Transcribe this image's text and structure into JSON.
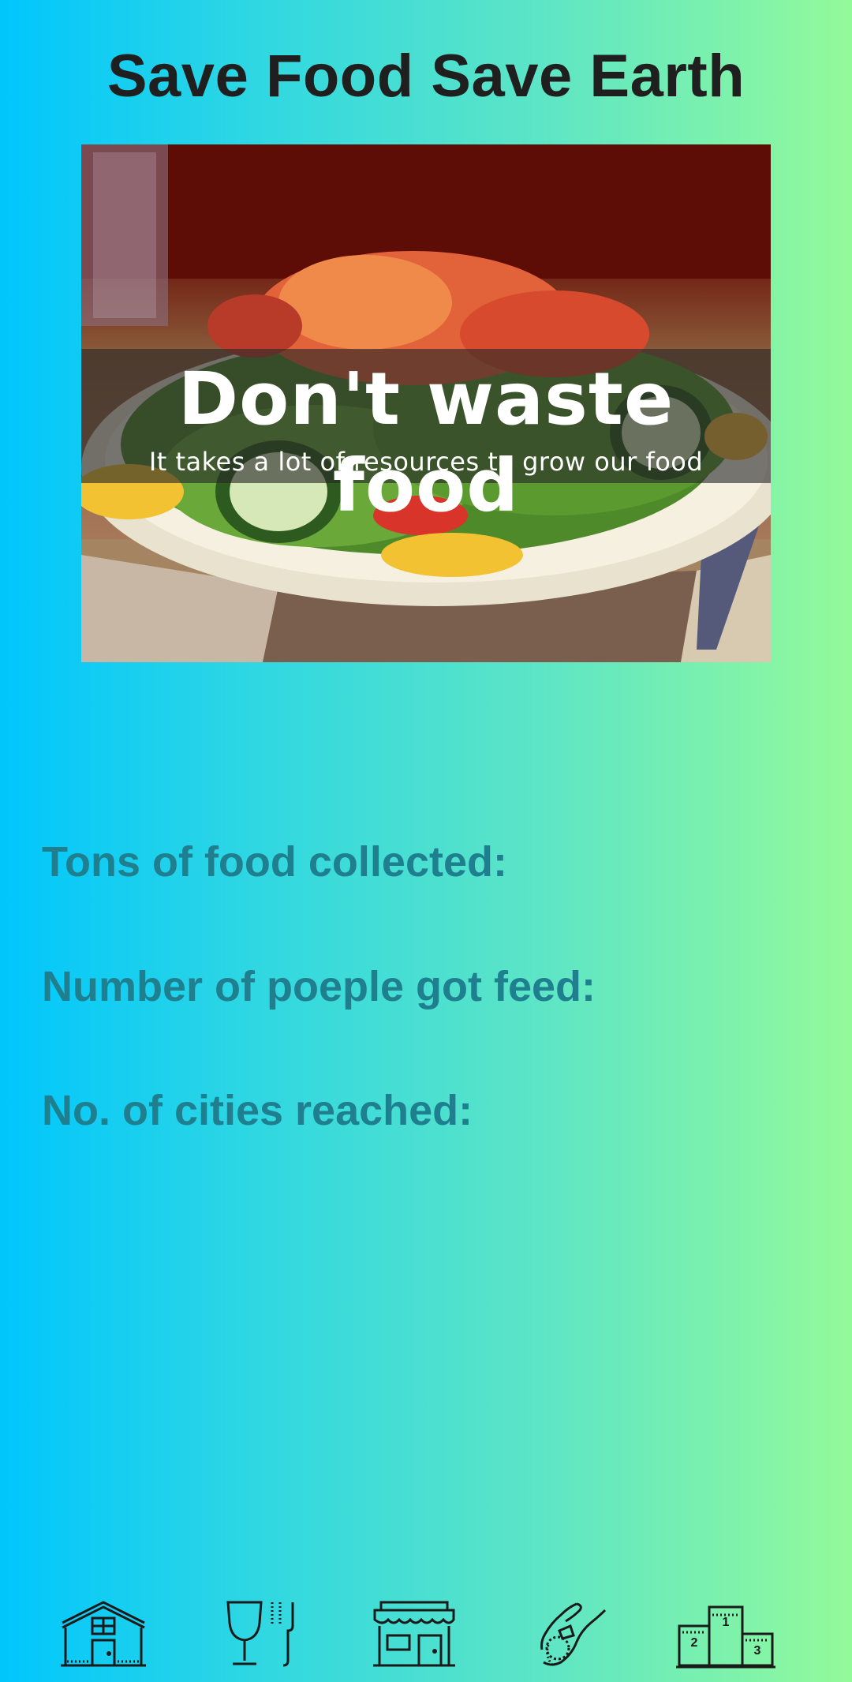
{
  "header": {
    "title": "Save Food Save Earth"
  },
  "hero": {
    "headline": "Don't waste food",
    "subtext": "It takes a lot of resources to grow our food"
  },
  "stats": {
    "tons_label": "Tons of food collected:",
    "people_label": "Number of poeple got feed:",
    "cities_label": "No. of cities reached:"
  },
  "nav": {
    "items": [
      {
        "icon": "home-icon"
      },
      {
        "icon": "food-icon"
      },
      {
        "icon": "shop-icon"
      },
      {
        "icon": "donate-icon"
      },
      {
        "icon": "leaderboard-icon"
      }
    ],
    "rank_labels": [
      "1",
      "2",
      "3"
    ]
  },
  "colors": {
    "gradient_start": "#00c6fd",
    "gradient_end": "#93fa9a",
    "title": "#1f1f1f",
    "stat_text": "#1f7f8f"
  }
}
